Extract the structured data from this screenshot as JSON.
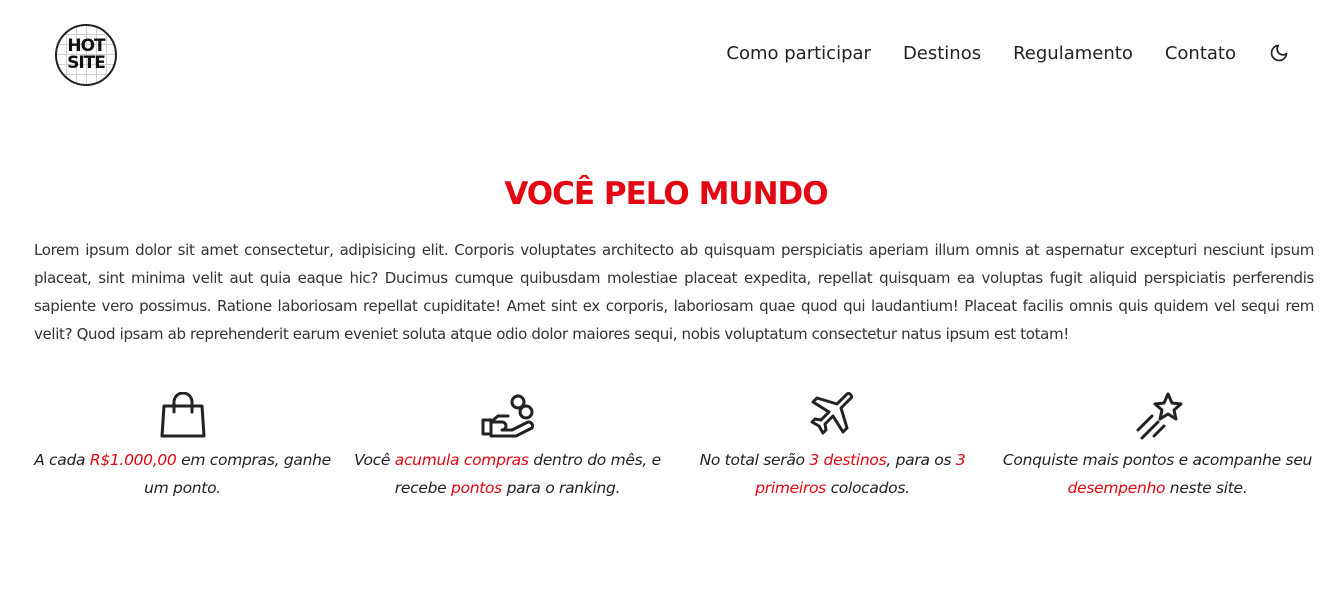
{
  "header": {
    "logo": {
      "line1": "HOT",
      "line2": "SITE"
    },
    "nav": [
      {
        "label": "Como participar"
      },
      {
        "label": "Destinos"
      },
      {
        "label": "Regulamento"
      },
      {
        "label": "Contato"
      }
    ],
    "theme_toggle_icon": "moon-icon"
  },
  "main": {
    "title": "VOCÊ PELO MUNDO",
    "intro": "Lorem ipsum dolor sit amet consectetur, adipisicing elit. Corporis voluptates architecto ab quisquam perspiciatis aperiam illum omnis at aspernatur excepturi nesciunt ipsum placeat, sint minima velit aut quia eaque hic? Ducimus cumque quibusdam molestiae placeat expedita, repellat quisquam ea voluptas fugit aliquid perspiciatis perferendis sapiente vero possimus. Ratione laboriosam repellat cupiditate! Amet sint ex corporis, laboriosam quae quod qui laudantium! Placeat facilis omnis quis quidem vel sequi rem velit? Quod ipsam ab reprehenderit earum eveniet soluta atque odio dolor maiores sequi, nobis voluptatum consectetur natus ipsum est totam!",
    "features": [
      {
        "icon": "shopping-bag-icon",
        "parts": [
          {
            "text": "A cada ",
            "hl": false
          },
          {
            "text": "R$1.000,00",
            "hl": true
          },
          {
            "text": " em compras, ganhe um ponto.",
            "hl": false
          }
        ]
      },
      {
        "icon": "hand-coins-icon",
        "parts": [
          {
            "text": "Você ",
            "hl": false
          },
          {
            "text": "acumula compras",
            "hl": true
          },
          {
            "text": " dentro do mês, e recebe ",
            "hl": false
          },
          {
            "text": "pontos",
            "hl": true
          },
          {
            "text": " para o ranking.",
            "hl": false
          }
        ]
      },
      {
        "icon": "airplane-icon",
        "parts": [
          {
            "text": "No total serão ",
            "hl": false
          },
          {
            "text": "3 destinos",
            "hl": true
          },
          {
            "text": ", para os ",
            "hl": false
          },
          {
            "text": "3 primeiros",
            "hl": true
          },
          {
            "text": " colocados.",
            "hl": false
          }
        ]
      },
      {
        "icon": "shooting-star-icon",
        "parts": [
          {
            "text": "Conquiste mais pontos e acompanhe seu ",
            "hl": false
          },
          {
            "text": "desempenho",
            "hl": true
          },
          {
            "text": " neste site.",
            "hl": false
          }
        ]
      }
    ]
  },
  "colors": {
    "accent": "#e30613",
    "text": "#222222",
    "background": "#ffffff"
  }
}
